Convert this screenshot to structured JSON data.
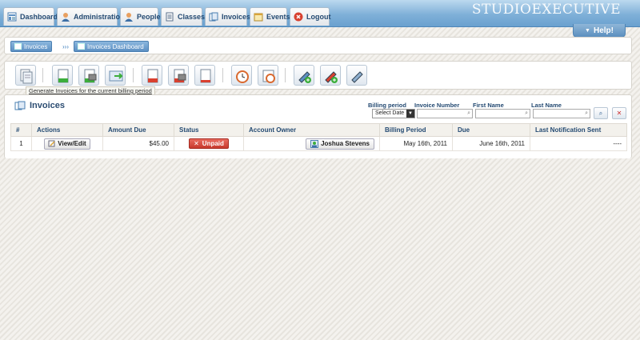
{
  "nav": {
    "tabs": [
      {
        "label": "Dashboard"
      },
      {
        "label": "Administration"
      },
      {
        "label": "People"
      },
      {
        "label": "Classes"
      },
      {
        "label": "Invoices"
      },
      {
        "label": "Events"
      },
      {
        "label": "Logout"
      }
    ],
    "brand_left": "STUDIO",
    "brand_right": "EXECUTIVE",
    "help_label": "Help!"
  },
  "breadcrumb": {
    "items": [
      "Invoices",
      "Invoices Dashboard"
    ],
    "separator": "›››"
  },
  "toolbar": {
    "tooltip": "Generate Invoices for the current billing period"
  },
  "main": {
    "title": "Invoices",
    "filters": {
      "billing_period_label": "Billing period",
      "billing_period_value": "Select Date",
      "invoice_number_label": "Invoice Number",
      "first_name_label": "First Name",
      "last_name_label": "Last Name"
    },
    "columns": [
      "#",
      "Actions",
      "Amount Due",
      "Status",
      "Account Owner",
      "Billing Period",
      "Due",
      "Last Notification Sent"
    ],
    "rows": [
      {
        "num": "1",
        "action": "View/Edit",
        "amount": "$45.00",
        "status": "Unpaid",
        "owner": "Joshua Stevens",
        "billing_period": "May 16th, 2011",
        "due": "June 16th, 2011",
        "last_sent": "----"
      }
    ]
  },
  "colors": {
    "nav_blue": "#6aa1cf",
    "heading_blue": "#244a72",
    "unpaid_red": "#c83a2e"
  }
}
